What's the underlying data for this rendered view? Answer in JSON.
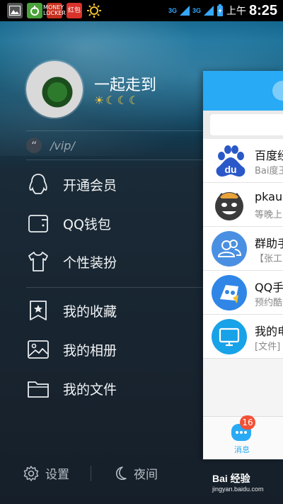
{
  "status_bar": {
    "left_icons": [
      "image-icon",
      "app-icon-green",
      "money-locker-icon",
      "red-packet-icon",
      "sun-icon"
    ],
    "money_locker_text": "MONEY LOCKER",
    "red_packet_text": "红包",
    "network_1": "3G",
    "network_2": "3G",
    "ampm": "上午",
    "time": "8:25"
  },
  "profile": {
    "nickname": "一起走到",
    "level_icons": "☀☾☾☾",
    "signature": "/vip/"
  },
  "menu": {
    "items": [
      {
        "label": "开通会员",
        "icon": "penguin-icon"
      },
      {
        "label": "QQ钱包",
        "icon": "wallet-icon"
      },
      {
        "label": "个性装扮",
        "icon": "tshirt-icon"
      },
      {
        "label": "我的收藏",
        "icon": "bookmark-star-icon"
      },
      {
        "label": "我的相册",
        "icon": "album-icon"
      },
      {
        "label": "我的文件",
        "icon": "folder-icon"
      }
    ]
  },
  "bottom": {
    "settings": "设置",
    "night": "夜间"
  },
  "chats": [
    {
      "name": "百度经",
      "preview": "Bai度王",
      "avatar_color": "#2a58c8"
    },
    {
      "name": "pkaus",
      "preview": "等晚上",
      "avatar_color": "#e8a23a"
    },
    {
      "name": "群助手",
      "preview": "【张工",
      "avatar_color": "#4a90e2"
    },
    {
      "name": "QQ手游",
      "preview": "预约酷",
      "avatar_color": "#2f86e6"
    },
    {
      "name": "我的电",
      "preview": "[文件]",
      "avatar_color": "#18a2e8"
    }
  ],
  "tabbar": {
    "messages_label": "消息",
    "messages_badge": "16"
  },
  "watermark": {
    "text": "Bai 经验",
    "url": "jingyan.baidu.com"
  },
  "colors": {
    "accent": "#28aaf5",
    "badge": "#f25135"
  }
}
